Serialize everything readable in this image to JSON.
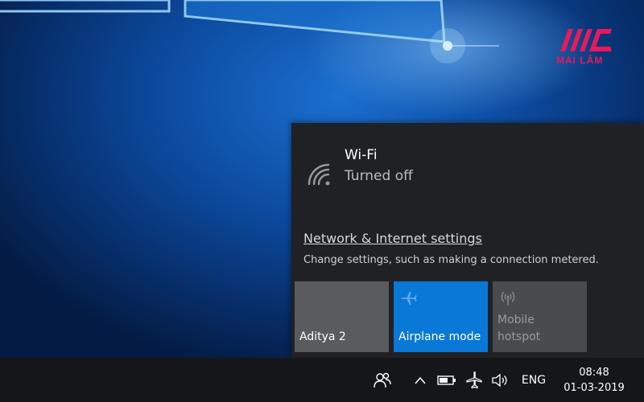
{
  "brand": {
    "text": "MAI LÂM"
  },
  "flyout": {
    "wifi": {
      "name": "Wi-Fi",
      "status": "Turned off",
      "icon": "wifi-icon"
    },
    "network_settings": {
      "link_label": "Network & Internet settings",
      "description": "Change settings, such as making a connection metered."
    },
    "tiles": [
      {
        "label": "Aditya 2",
        "icon": "",
        "state": "off"
      },
      {
        "label": "Airplane mode",
        "icon": "airplane-icon",
        "state": "on"
      },
      {
        "label": "Mobile hotspot",
        "icon": "hotspot-icon",
        "state": "disabled"
      }
    ]
  },
  "taskbar": {
    "language": "ENG",
    "time": "08:48",
    "date": "01-03-2019",
    "icons": [
      "people-icon",
      "chevron-up-icon",
      "battery-icon",
      "airplane-icon",
      "volume-icon"
    ]
  },
  "colors": {
    "flyout_bg": "#1f2125",
    "tile_active": "#0a78d7",
    "tile_inactive": "#5a5b5f",
    "taskbar_bg": "#151619",
    "brand_accent": "#e8195e"
  }
}
